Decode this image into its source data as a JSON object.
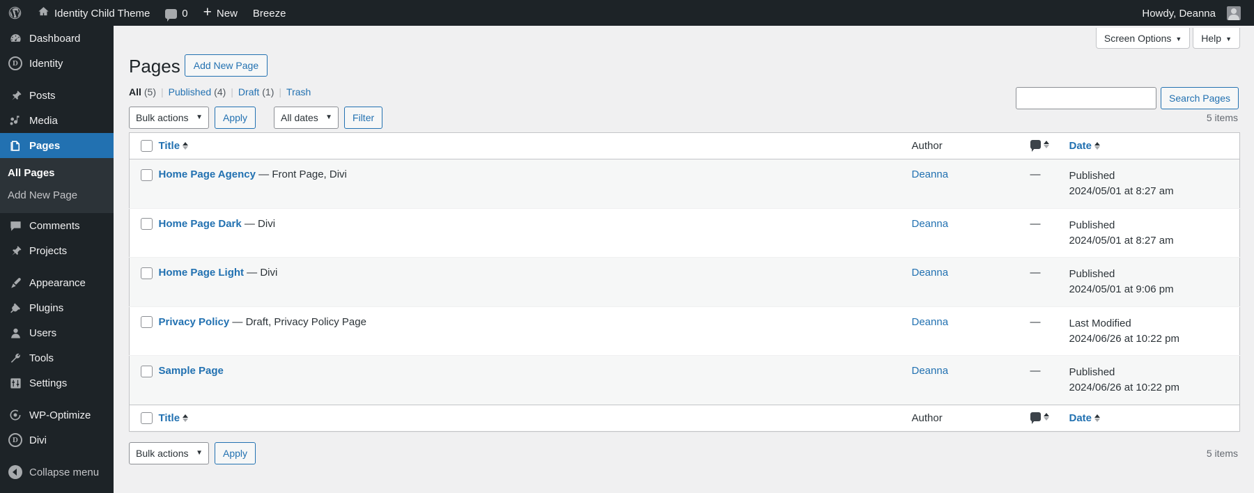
{
  "adminbar": {
    "logo_icon": "wordpress-logo-icon",
    "site_icon": "home-icon",
    "site_name": "Identity Child Theme",
    "comments_icon": "comment-bubble-icon",
    "comments_count": "0",
    "new_icon": "plus-icon",
    "new_label": "New",
    "breeze_label": "Breeze",
    "howdy": "Howdy, Deanna",
    "avatar_icon": "user-avatar-icon"
  },
  "sidebar": {
    "items": [
      {
        "label": "Dashboard",
        "icon": "dashboard-icon",
        "current": false
      },
      {
        "label": "Identity",
        "icon": "divi-circle-d-icon",
        "current": false
      },
      {
        "label": "Posts",
        "icon": "pin-icon",
        "current": false
      },
      {
        "label": "Media",
        "icon": "media-icon",
        "current": false
      },
      {
        "label": "Pages",
        "icon": "pages-icon",
        "current": true
      },
      {
        "label": "Comments",
        "icon": "comment-icon",
        "current": false
      },
      {
        "label": "Projects",
        "icon": "pin-icon",
        "current": false
      },
      {
        "label": "Appearance",
        "icon": "paintbrush-icon",
        "current": false
      },
      {
        "label": "Plugins",
        "icon": "plug-icon",
        "current": false
      },
      {
        "label": "Users",
        "icon": "user-icon",
        "current": false
      },
      {
        "label": "Tools",
        "icon": "wrench-icon",
        "current": false
      },
      {
        "label": "Settings",
        "icon": "sliders-icon",
        "current": false
      },
      {
        "label": "WP-Optimize",
        "icon": "wp-optimize-icon",
        "current": false
      },
      {
        "label": "Divi",
        "icon": "divi-circle-d-icon",
        "current": false
      },
      {
        "label": "Collapse menu",
        "icon": "collapse-arrow-icon",
        "current": false
      }
    ],
    "submenu": [
      {
        "label": "All Pages",
        "current": true
      },
      {
        "label": "Add New Page",
        "current": false
      }
    ]
  },
  "screen_meta": {
    "screen_options": "Screen Options",
    "help": "Help",
    "caret_icon": "chevron-down-icon"
  },
  "header": {
    "title": "Pages",
    "add_new_label": "Add New Page"
  },
  "filters": {
    "links": [
      {
        "label": "All",
        "count": "(5)",
        "current": true
      },
      {
        "label": "Published",
        "count": "(4)",
        "current": false
      },
      {
        "label": "Draft",
        "count": "(1)",
        "current": false
      },
      {
        "label": "Trash",
        "count": "",
        "current": false
      }
    ],
    "separator": "|"
  },
  "search": {
    "value": "",
    "placeholder": "",
    "button_label": "Search Pages"
  },
  "tablenav_top": {
    "bulk_actions_selected": "Bulk actions",
    "apply_label": "Apply",
    "dates_selected": "All dates",
    "filter_label": "Filter",
    "displaying_num": "5 items"
  },
  "tablenav_bottom": {
    "bulk_actions_selected": "Bulk actions",
    "apply_label": "Apply",
    "displaying_num": "5 items"
  },
  "table": {
    "columns": {
      "title": "Title",
      "author": "Author",
      "comments_icon": "comment-bubble-icon",
      "date": "Date"
    },
    "rows": [
      {
        "title": "Home Page Agency",
        "state": " — Front Page, Divi",
        "author": "Deanna",
        "comments": "—",
        "date_label": "Published",
        "date_value": "2024/05/01 at 8:27 am"
      },
      {
        "title": "Home Page Dark",
        "state": " — Divi",
        "author": "Deanna",
        "comments": "—",
        "date_label": "Published",
        "date_value": "2024/05/01 at 8:27 am"
      },
      {
        "title": "Home Page Light",
        "state": " — Divi",
        "author": "Deanna",
        "comments": "—",
        "date_label": "Published",
        "date_value": "2024/05/01 at 9:06 pm"
      },
      {
        "title": "Privacy Policy",
        "state": " — Draft, Privacy Policy Page",
        "author": "Deanna",
        "comments": "—",
        "date_label": "Last Modified",
        "date_value": "2024/06/26 at 10:22 pm"
      },
      {
        "title": "Sample Page",
        "state": "",
        "author": "Deanna",
        "comments": "—",
        "date_label": "Published",
        "date_value": "2024/06/26 at 10:22 pm"
      }
    ]
  },
  "colors": {
    "admin_dark": "#1d2327",
    "admin_submenu": "#2c3338",
    "accent_blue": "#2271b1",
    "page_bg": "#f0f0f1",
    "row_alt": "#f6f7f7"
  }
}
